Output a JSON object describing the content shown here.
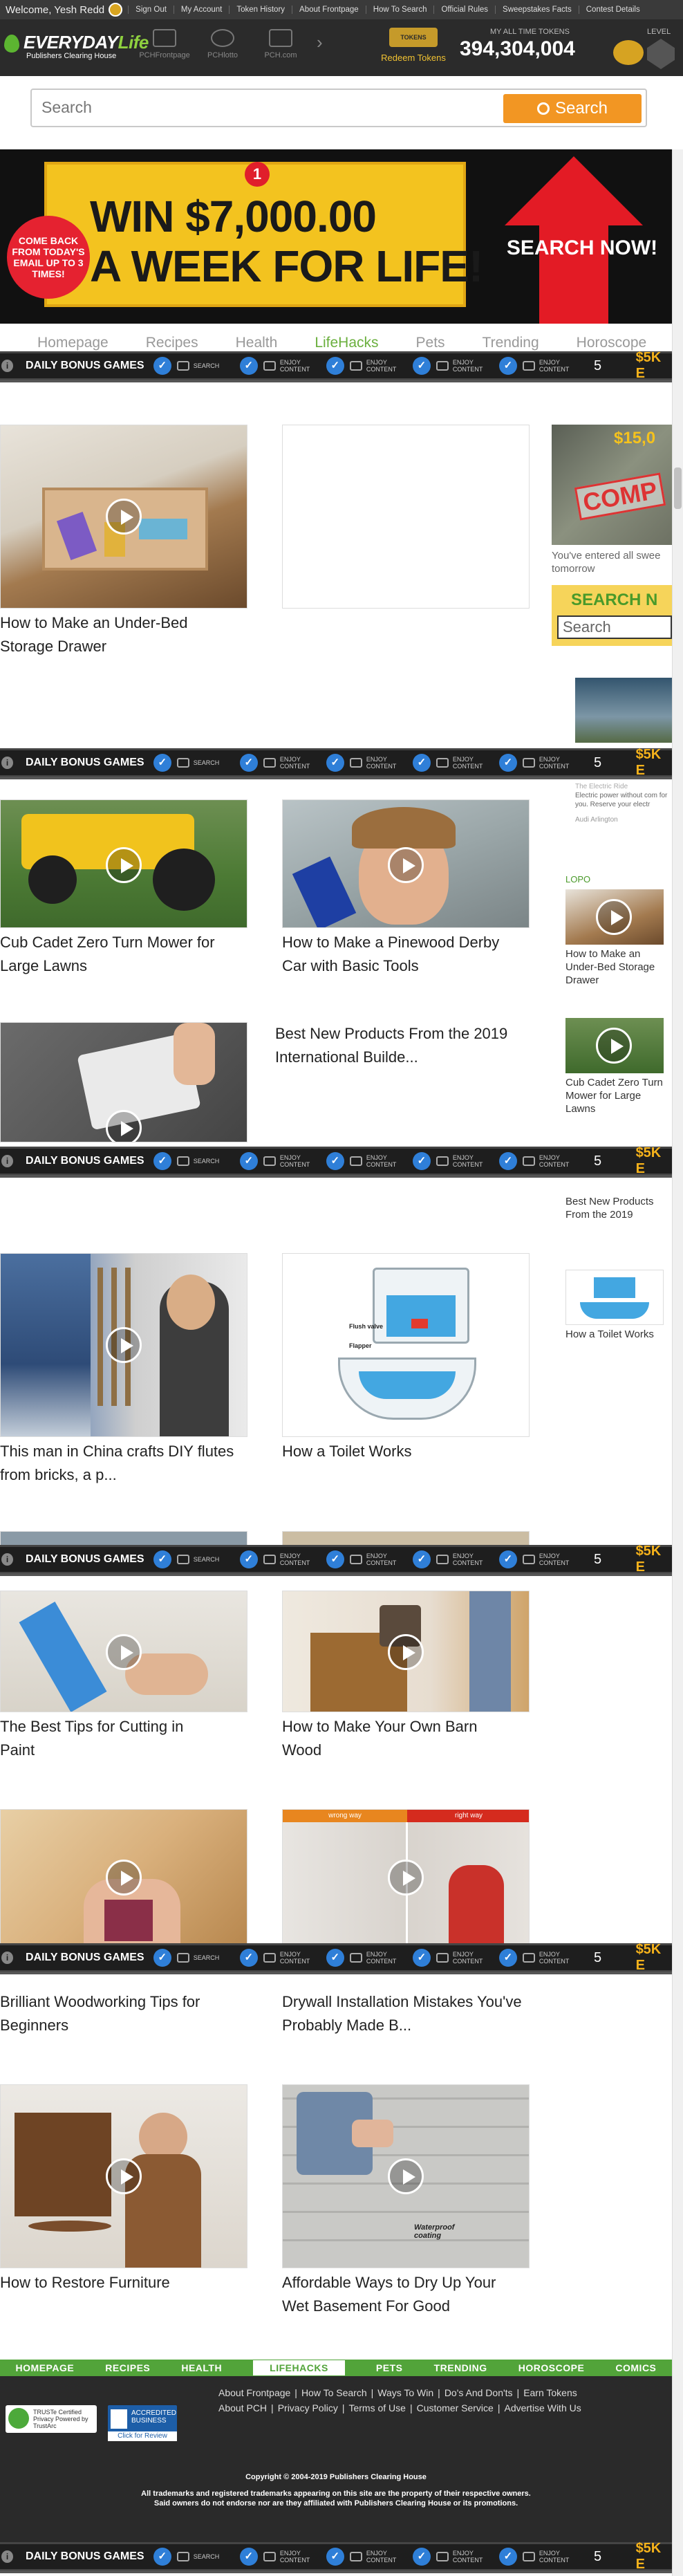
{
  "topbar": {
    "welcome": "Welcome, Yesh Redd",
    "links": [
      "Sign Out",
      "My Account",
      "Token History",
      "About Frontpage",
      "How To Search",
      "Official Rules",
      "Sweepstakes Facts",
      "Contest Details"
    ]
  },
  "header": {
    "logo_main": "EVERYDAY",
    "logo_accent": "Life",
    "logo_sub": "Publishers Clearing House",
    "nav": [
      "PCHFrontpage",
      "PCHlotto",
      "PCH.com"
    ],
    "redeem_badge": "TOKENS",
    "redeem_label": "Redeem Tokens",
    "tokens_label": "MY ALL TIME TOKENS",
    "tokens_value": "394,304,004",
    "level_label": "LEVEL"
  },
  "search": {
    "placeholder": "Search",
    "button": "Search"
  },
  "banner": {
    "number": "1",
    "line1": "WIN $7,000.00",
    "line2": "A WEEK FOR LIFE!",
    "burst": "COME BACK FROM TODAY'S EMAIL UP TO 3 TIMES!",
    "cta": "SEARCH NOW!"
  },
  "categories": [
    "Homepage",
    "Recipes",
    "Health",
    "LifeHacks",
    "Pets",
    "Trending",
    "Horoscope"
  ],
  "active_category": "LifeHacks",
  "bonus_bar": {
    "title": "DAILY BONUS GAMES",
    "games": [
      "SEARCH",
      "ENJOY CONTENT",
      "ENJOY CONTENT",
      "ENJOY CONTENT",
      "ENJOY CONTENT"
    ],
    "count": "5",
    "prize": "$5K E"
  },
  "articles": [
    {
      "title": "How to Make an Under-Bed Storage Drawer"
    },
    {
      "title": "Cub Cadet Zero Turn Mower for Large Lawns"
    },
    {
      "title": "How to Make a Pinewood Derby Car with Basic Tools"
    },
    {
      "title": "Best New Products From the 2019 International Builde..."
    },
    {
      "title": "This man in China crafts DIY flutes from bricks, a p..."
    },
    {
      "title": "How a Toilet Works"
    },
    {
      "title": "The Best Tips for Cutting in Paint"
    },
    {
      "title": "How to Make Your Own Barn Wood"
    },
    {
      "title": "Brilliant Woodworking Tips for Beginners"
    },
    {
      "title": "Drywall Installation Mistakes You've Probably Made B..."
    },
    {
      "title": "How to Restore Furniture"
    },
    {
      "title": "Affordable Ways to Dry Up Your Wet Basement For Good"
    }
  ],
  "rail": {
    "promo_amount": "$15,0",
    "promo_stamp": "COMP",
    "promo_text": "You've entered all swee tomorrow",
    "promo_search": "SEARCH N",
    "promo_input": "Search",
    "ad_text1": "The Electric Ride",
    "ad_text2": "Electric power without com for you. Reserve your electr",
    "ad_text3": "Audi Arlington",
    "section": "LOPO",
    "items": [
      "How to Make an Under-Bed Storage Drawer",
      "Cub Cadet Zero Turn Mower for Large Lawns",
      "Best New Products From the 2019",
      "How a Toilet Works"
    ]
  },
  "toilet": {
    "flush": "Flush valve",
    "flapper": "Flapper"
  },
  "drywall": {
    "wrong": "wrong way",
    "right": "right way"
  },
  "basement": {
    "label": "Waterproof coating"
  },
  "footer": {
    "nav": [
      "HOMEPAGE",
      "RECIPES",
      "HEALTH",
      "LIFEHACKS",
      "PETS",
      "TRENDING",
      "HOROSCOPE",
      "COMICS"
    ],
    "links1": [
      "About Frontpage",
      "How To Search",
      "Ways To Win",
      "Do's And Don'ts",
      "Earn Tokens"
    ],
    "links2": [
      "About PCH",
      "Privacy Policy",
      "Terms of Use",
      "Customer Service",
      "Advertise With Us"
    ],
    "truste": "TRUSTe Certified Privacy Powered by TrustArc",
    "bbb": "ACCREDITED BUSINESS",
    "bbb_sub": "Click for Review",
    "copyright": "Copyright © 2004-2019 Publishers Clearing House",
    "disclaimer1": "All trademarks and registered trademarks appearing on this site are the property of their respective owners.",
    "disclaimer2": "Said owners do not endorse nor are they affiliated with Publishers Clearing House or its promotions."
  }
}
